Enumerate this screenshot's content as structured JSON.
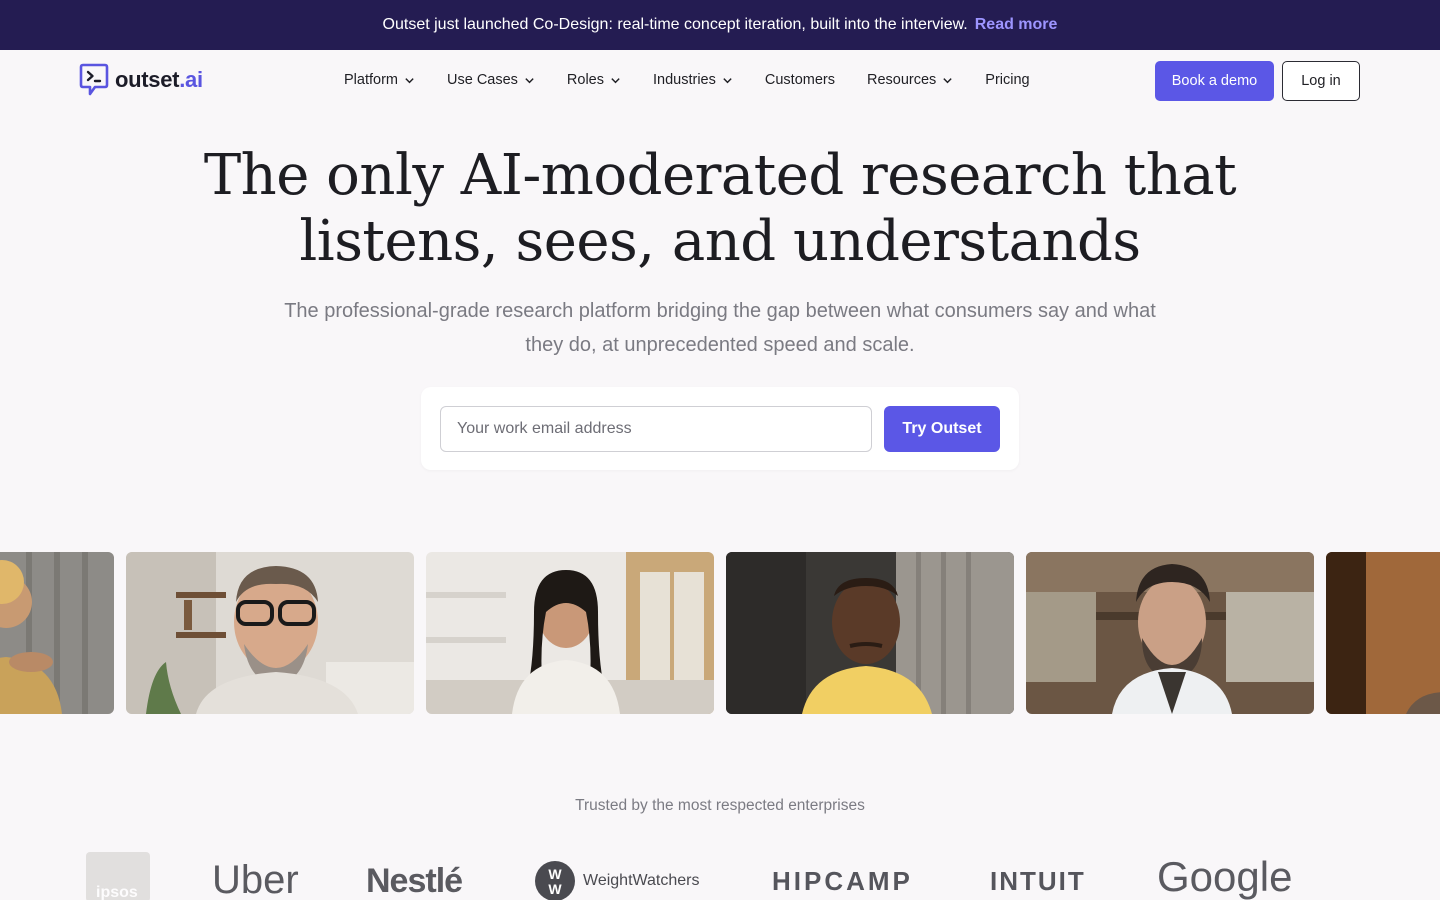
{
  "announcement": {
    "text": "Outset just launched Co-Design: real-time concept iteration, built into the interview.",
    "link": "Read more"
  },
  "brand": {
    "name_main": "outset",
    "name_suffix": ".ai"
  },
  "nav": {
    "items": [
      {
        "label": "Platform",
        "dropdown": true
      },
      {
        "label": "Use Cases",
        "dropdown": true
      },
      {
        "label": "Roles",
        "dropdown": true
      },
      {
        "label": "Industries",
        "dropdown": true
      },
      {
        "label": "Customers",
        "dropdown": false
      },
      {
        "label": "Resources",
        "dropdown": true
      },
      {
        "label": "Pricing",
        "dropdown": false
      }
    ],
    "book_demo": "Book a demo",
    "login": "Log in"
  },
  "hero": {
    "title_line1": "The only AI-moderated research that",
    "title_line2": "listens, sees, and understands",
    "subtitle": "The professional-grade research platform bridging the gap between what consumers say and what they do, at unprecedented speed and scale.",
    "email_placeholder": "Your work email address",
    "cta": "Try Outset"
  },
  "trusted": {
    "heading": "Trusted by the most respected enterprises",
    "logos": [
      "ipsos",
      "Uber",
      "Nestlé",
      "WeightWatchers",
      "HIPCAMP",
      "INTUIT",
      "Google"
    ]
  },
  "colors": {
    "accent": "#5b57e6",
    "banner_bg": "#241c52",
    "banner_link": "#9d95ff",
    "page_bg": "#f9f7f9"
  }
}
